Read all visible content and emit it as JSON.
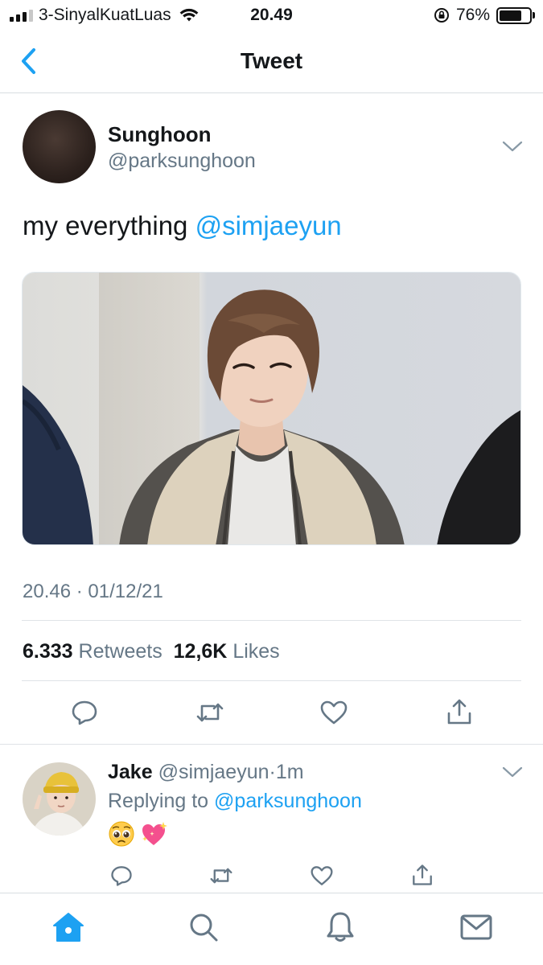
{
  "status_bar": {
    "carrier": "3-SinyalKuatLuas",
    "time": "20.49",
    "battery_percent": "76%",
    "battery_level": 0.76
  },
  "nav": {
    "title": "Tweet",
    "back_icon": "chevron-left-icon"
  },
  "tweet": {
    "author_name": "Sunghoon",
    "author_handle": "@parksunghoon",
    "text": "my everything",
    "mention": "@simjaeyun",
    "timestamp": "20.46 · 01/12/21",
    "retweets_count": "6.333",
    "retweets_label": "Retweets",
    "likes_count": "12,6K",
    "likes_label": "Likes",
    "actions": [
      "reply-icon",
      "retweet-icon",
      "like-icon",
      "share-icon"
    ]
  },
  "reply": {
    "author_name": "Jake",
    "author_handle": "@simjaeyun",
    "separator": "·",
    "age": "1m",
    "replying_to_label": "Replying to",
    "replying_to_handle": "@parksunghoon",
    "emojis": [
      "pleading-face-emoji",
      "sparkling-heart-emoji"
    ]
  },
  "tab_bar": {
    "tabs": [
      "home-icon",
      "search-icon",
      "notifications-icon",
      "messages-icon"
    ],
    "active": "home-icon"
  },
  "colors": {
    "accent": "#1da1f2",
    "secondary_text": "#657786",
    "icon_grey": "#657786"
  }
}
